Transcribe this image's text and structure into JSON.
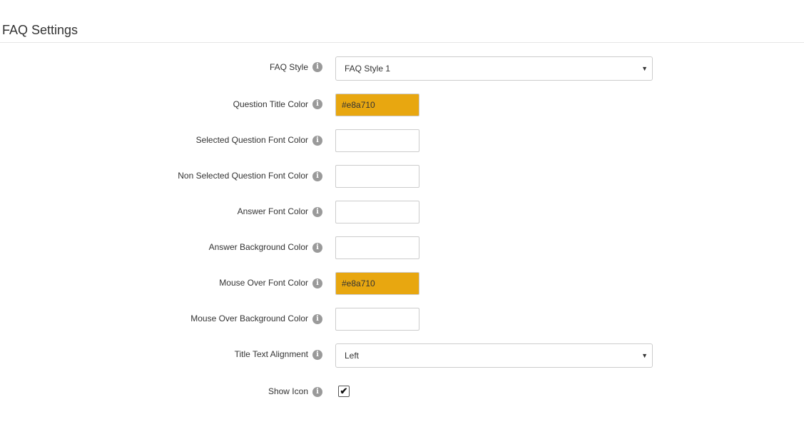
{
  "section": {
    "title": "FAQ Settings"
  },
  "fields": {
    "faq_style": {
      "label": "FAQ Style",
      "value": "FAQ Style 1",
      "icon": "info-icon"
    },
    "question_title_color": {
      "label": "Question Title Color",
      "value": "#e8a710",
      "swatch": "#e8a710",
      "icon": "info-icon"
    },
    "selected_question_font_color": {
      "label": "Selected Question Font Color",
      "value": "",
      "icon": "info-icon"
    },
    "non_selected_question_font_color": {
      "label": "Non Selected Question Font Color",
      "value": "",
      "icon": "info-icon"
    },
    "answer_font_color": {
      "label": "Answer Font Color",
      "value": "",
      "icon": "info-icon"
    },
    "answer_background_color": {
      "label": "Answer Background Color",
      "value": "",
      "icon": "info-icon"
    },
    "mouse_over_font_color": {
      "label": "Mouse Over Font Color",
      "value": "#e8a710",
      "swatch": "#e8a710",
      "icon": "info-icon"
    },
    "mouse_over_background_color": {
      "label": "Mouse Over Background Color",
      "value": "",
      "icon": "info-icon"
    },
    "title_text_alignment": {
      "label": "Title Text Alignment",
      "value": "Left",
      "icon": "info-icon"
    },
    "show_icon": {
      "label": "Show Icon",
      "checked": true,
      "icon": "info-icon"
    }
  },
  "glyphs": {
    "info": "i",
    "caret": "▼",
    "check": "✔"
  },
  "colors": {
    "accent": "#e8a710",
    "border": "#cccccc",
    "info_icon": "#9a9a9a"
  }
}
